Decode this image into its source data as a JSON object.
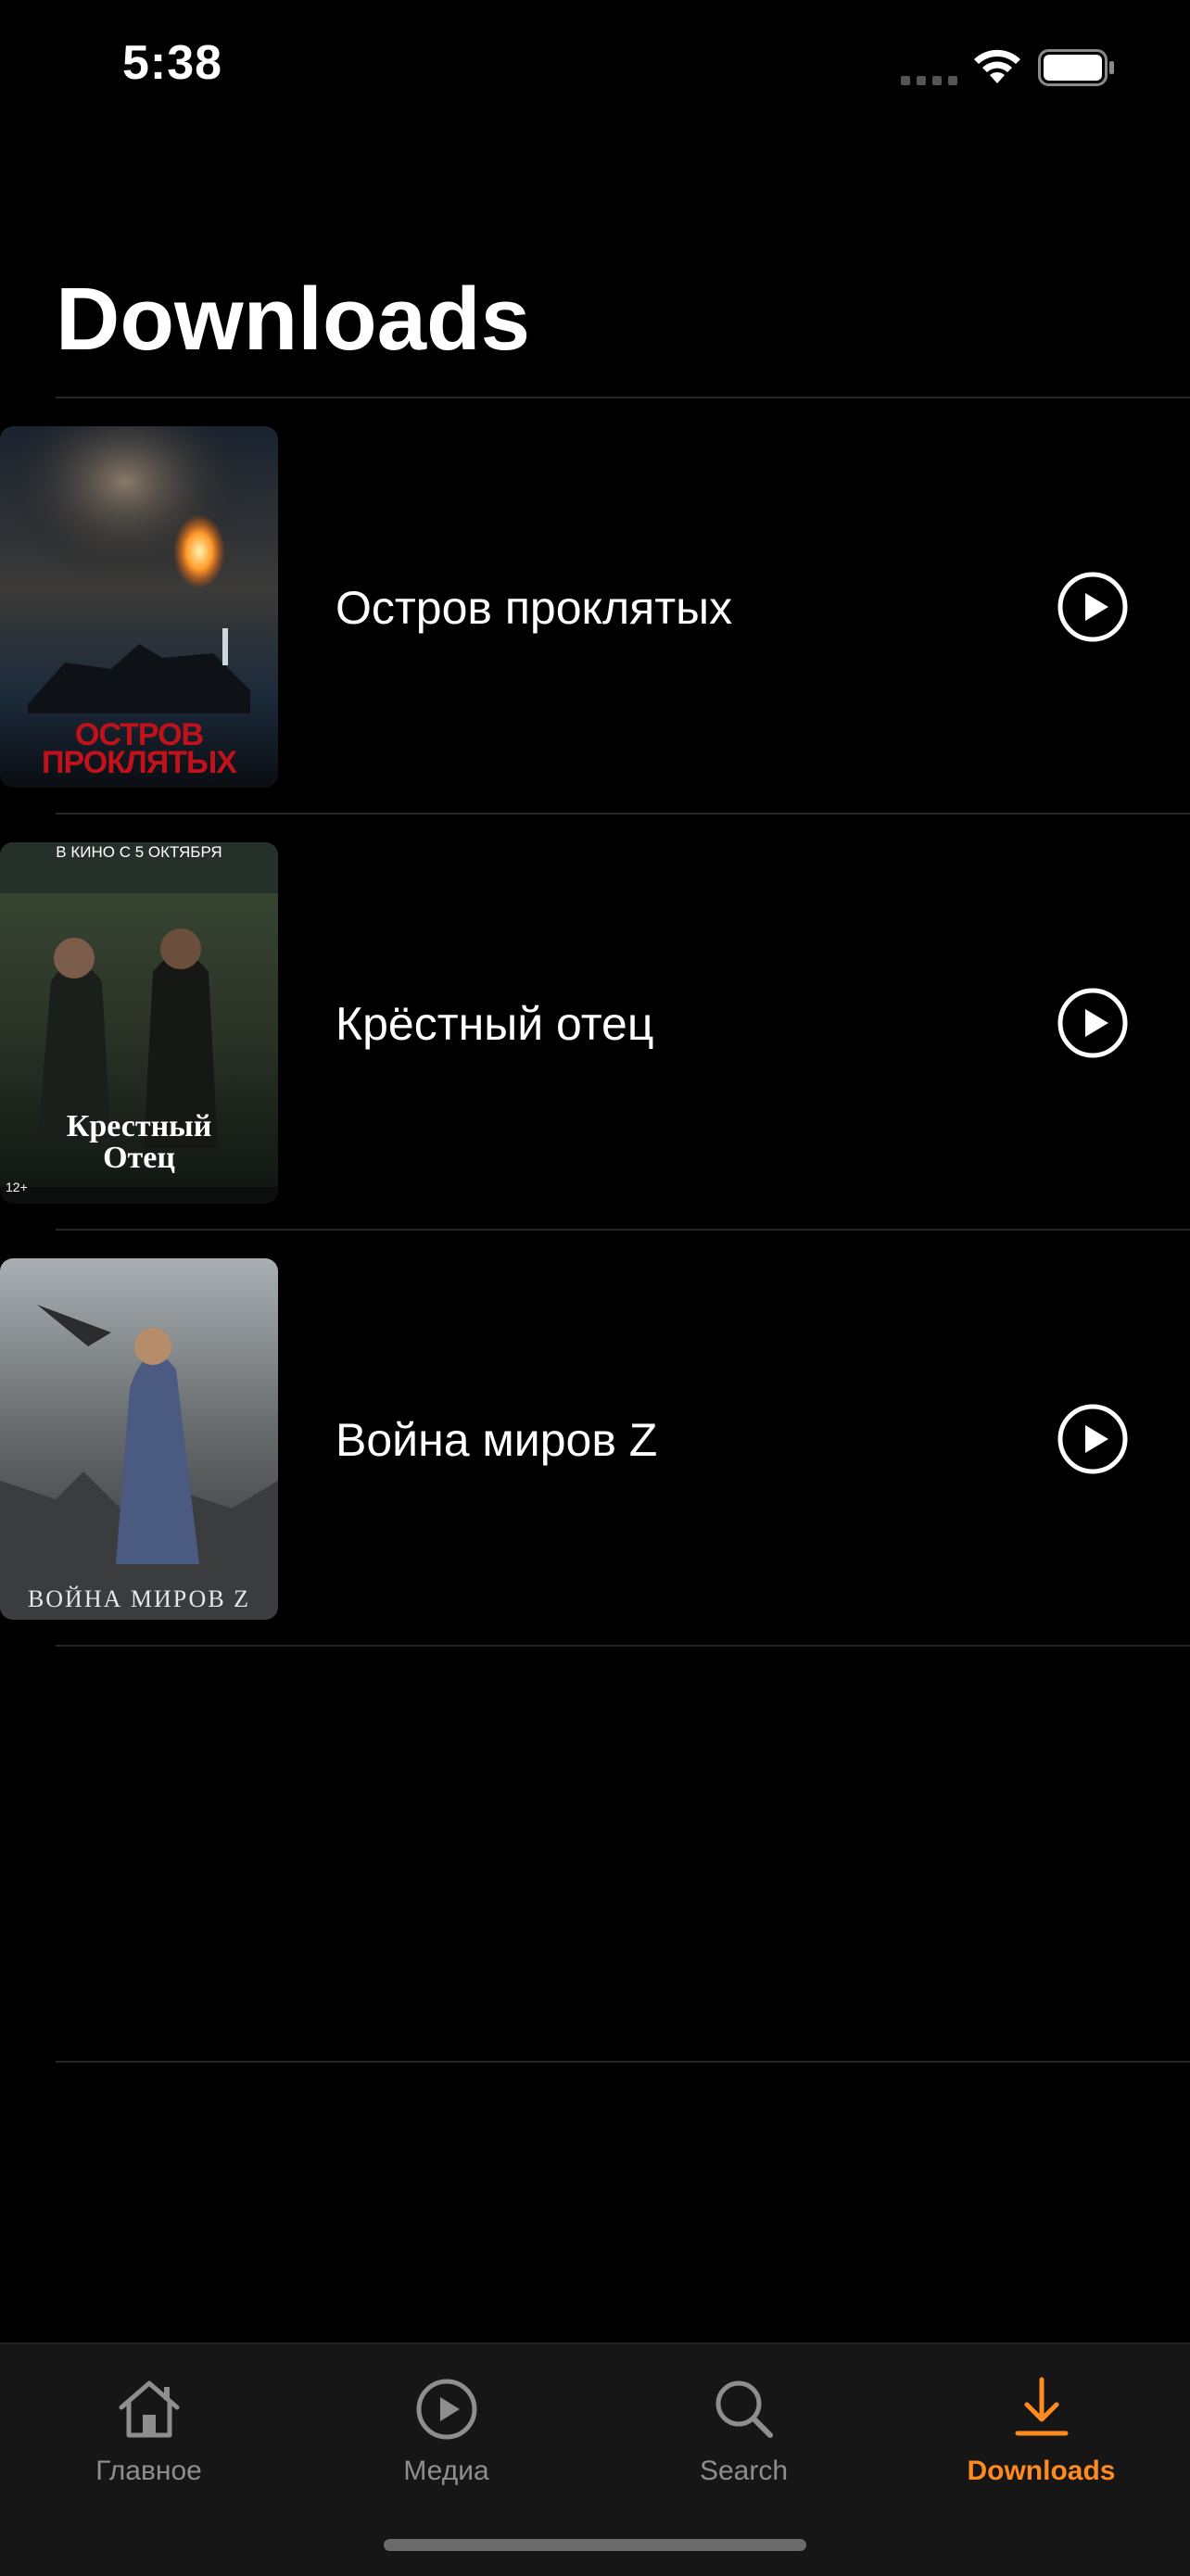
{
  "status_bar": {
    "time": "5:38",
    "signal_icon": "cellular-signal-icon",
    "wifi_icon": "wifi-icon",
    "battery_icon": "battery-icon"
  },
  "page": {
    "title": "Downloads"
  },
  "downloads": [
    {
      "title": "Остров проклятых",
      "poster_icon": "movie-poster",
      "action_icon": "play-circle-icon"
    },
    {
      "title": "Крёстный отец",
      "poster_icon": "movie-poster",
      "action_icon": "play-circle-icon"
    },
    {
      "title": "Война миров Z",
      "poster_icon": "movie-poster",
      "action_icon": "play-circle-icon"
    }
  ],
  "posters": {
    "poster_1_text": "ОСТРОВ ПРОКЛЯТЫХ",
    "poster_2_top": "В КИНО С 5 ОКТЯБРЯ",
    "poster_2_title": "Крестный Отец",
    "poster_2_age": "12+",
    "poster_3_text": "ВОЙНА МИРОВ Z"
  },
  "tab_bar": {
    "tabs": [
      {
        "label": "Главное",
        "icon": "home-icon",
        "active": false
      },
      {
        "label": "Медиа",
        "icon": "play-circle-icon",
        "active": false
      },
      {
        "label": "Search",
        "icon": "search-icon",
        "active": false
      },
      {
        "label": "Downloads",
        "icon": "download-icon",
        "active": true
      }
    ]
  },
  "colors": {
    "background": "#000000",
    "accent": "#ff8b1f",
    "inactive": "#8e8e8e",
    "divider": "#262626",
    "tab_bar_bg": "#161616"
  }
}
